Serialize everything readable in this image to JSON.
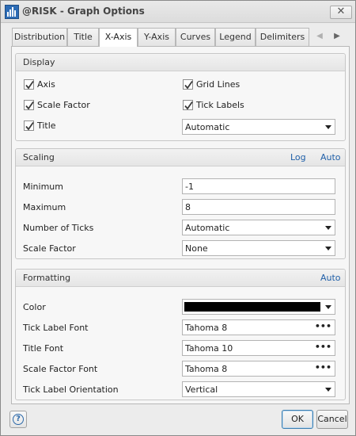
{
  "window": {
    "title": "@RISK - Graph Options",
    "close_glyph": "✕"
  },
  "tabs": [
    {
      "label": "Distribution",
      "active": false
    },
    {
      "label": "Title",
      "active": false
    },
    {
      "label": "X-Axis",
      "active": true
    },
    {
      "label": "Y-Axis",
      "active": false
    },
    {
      "label": "Curves",
      "active": false
    },
    {
      "label": "Legend",
      "active": false
    },
    {
      "label": "Delimiters",
      "active": false
    }
  ],
  "tab_scroll": {
    "left_glyph": "◀",
    "right_glyph": "▶"
  },
  "display": {
    "title": "Display",
    "checkboxes": [
      {
        "label": "Axis",
        "checked": true
      },
      {
        "label": "Grid Lines",
        "checked": true
      },
      {
        "label": "Scale Factor",
        "checked": true
      },
      {
        "label": "Tick Labels",
        "checked": true
      },
      {
        "label": "Title",
        "checked": true
      }
    ],
    "title_mode": "Automatic"
  },
  "scaling": {
    "title": "Scaling",
    "log_link": "Log",
    "auto_link": "Auto",
    "minimum_label": "Minimum",
    "minimum_value": "-1",
    "maximum_label": "Maximum",
    "maximum_value": "8",
    "ticks_label": "Number of Ticks",
    "ticks_value": "Automatic",
    "scale_factor_label": "Scale Factor",
    "scale_factor_value": "None"
  },
  "formatting": {
    "title": "Formatting",
    "auto_link": "Auto",
    "color_label": "Color",
    "color_value": "#000000",
    "tick_font_label": "Tick Label Font",
    "tick_font_value": "Tahoma 8",
    "title_font_label": "Title Font",
    "title_font_value": "Tahoma 10",
    "scale_font_label": "Scale Factor Font",
    "scale_font_value": "Tahoma 8",
    "orientation_label": "Tick Label Orientation",
    "orientation_value": "Vertical",
    "ellipsis": "•••"
  },
  "footer": {
    "help_glyph": "?",
    "ok_label": "OK",
    "cancel_label": "Cancel"
  },
  "colors": {
    "link": "#1f5fa8",
    "check": "#3a3a3a",
    "help": "#2a67a8"
  },
  "icons": {
    "app": "risk-chart-icon",
    "close": "close-icon",
    "check": "checkmark-icon",
    "dropdown": "chevron-down-icon",
    "browse": "ellipsis-icon",
    "help": "help-icon"
  }
}
